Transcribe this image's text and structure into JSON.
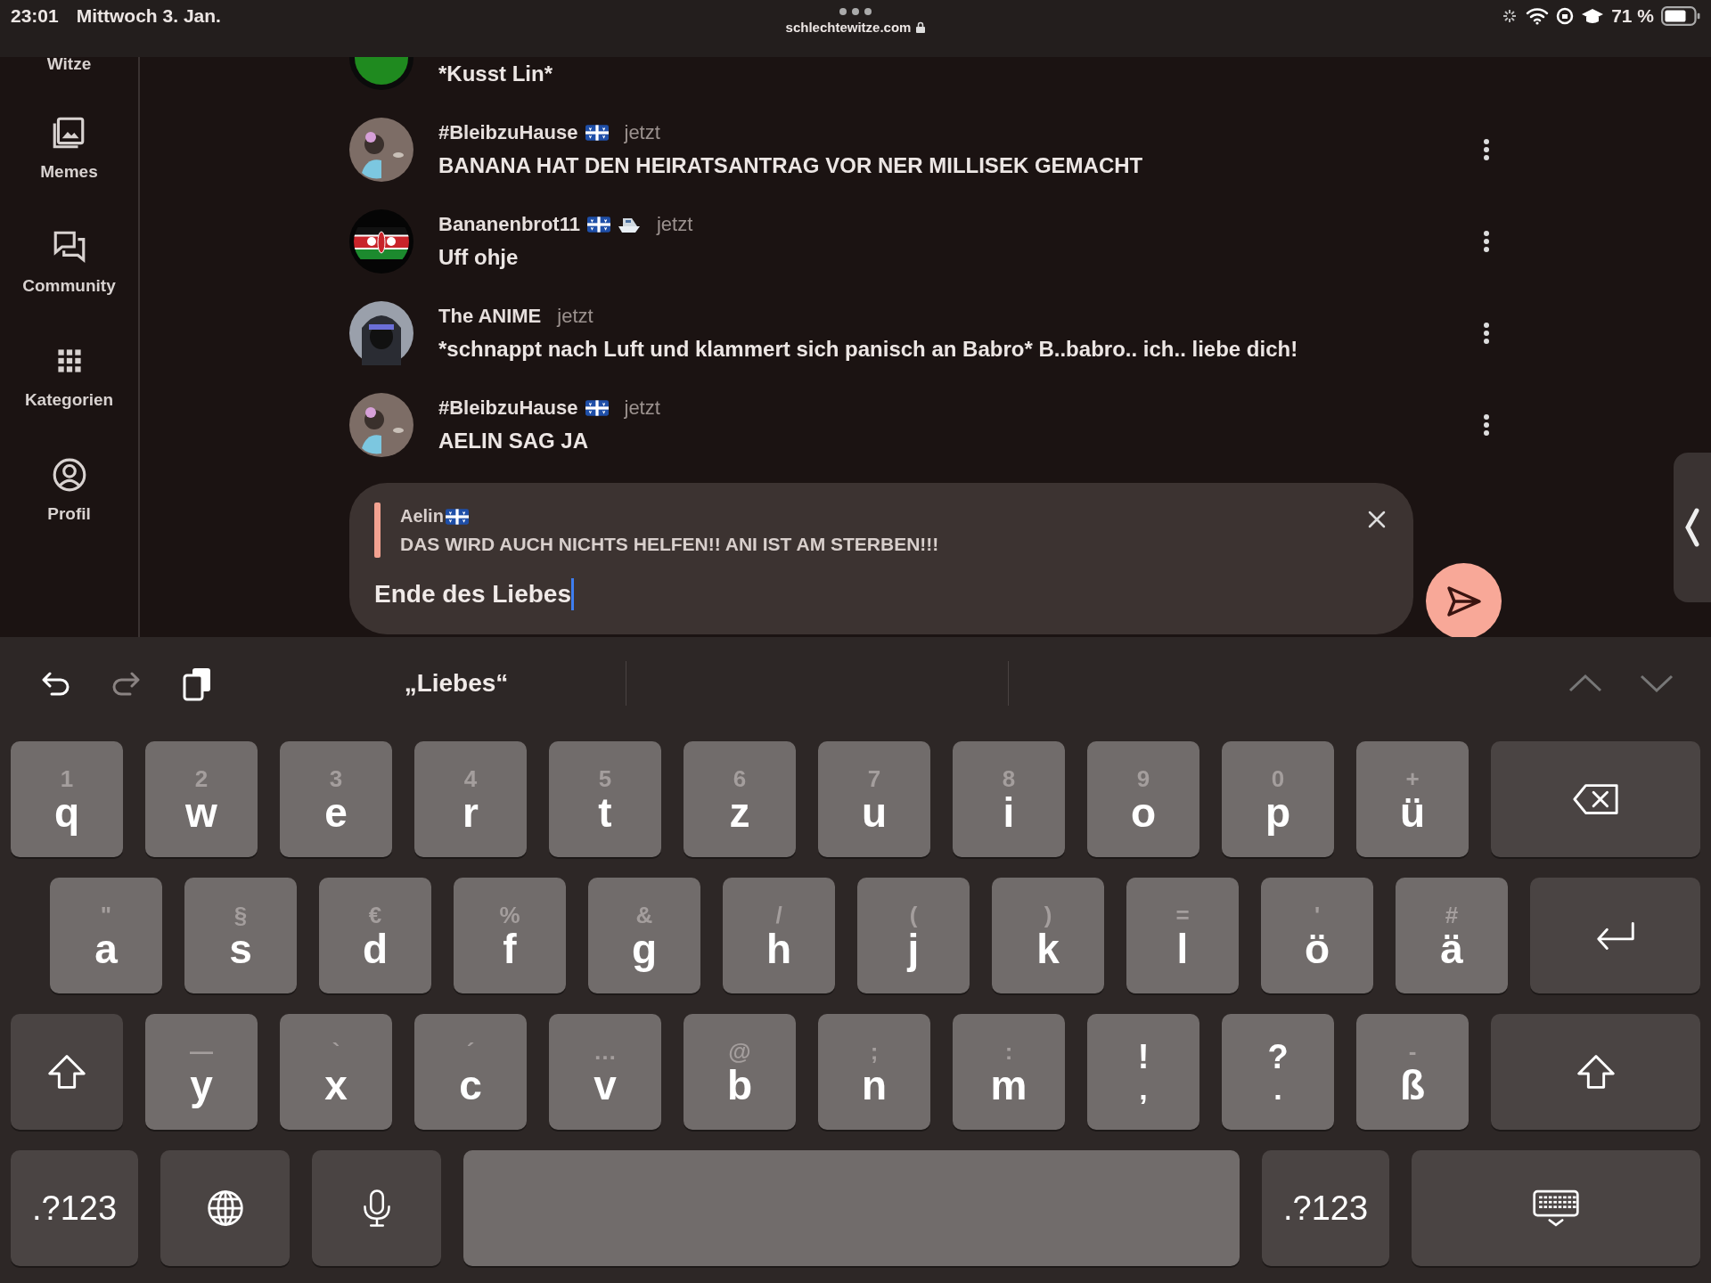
{
  "status_bar": {
    "time": "23:01",
    "date": "Mittwoch 3. Jan.",
    "url": "schlechtewitze.com",
    "battery": "71 %"
  },
  "sidebar": {
    "items": [
      {
        "label": "Witze"
      },
      {
        "label": "Memes"
      },
      {
        "label": "Community"
      },
      {
        "label": "Kategorien"
      },
      {
        "label": "Profil"
      }
    ]
  },
  "messages": [
    {
      "text": "*Kusst Lin*"
    },
    {
      "name": "#BleibzuHause",
      "flag": true,
      "boat": false,
      "time": "jetzt",
      "text": "BANANA HAT DEN HEIRATSANTRAG VOR NER MILLISEK GEMACHT"
    },
    {
      "name": "Bananenbrot11",
      "flag": true,
      "boat": true,
      "time": "jetzt",
      "text": "Uff ohje"
    },
    {
      "name": "The ANIME",
      "flag": false,
      "boat": false,
      "time": "jetzt",
      "text": "*schnappt nach Luft und klammert sich panisch an Babro* B..babro.. ich.. liebe dich!"
    },
    {
      "name": "#BleibzuHause",
      "flag": true,
      "boat": false,
      "time": "jetzt",
      "text": "AELIN SAG JA"
    }
  ],
  "composer": {
    "reply": {
      "name": "Aelin",
      "flag": true,
      "text": "DAS WIRD AUCH NICHTS HELFEN!! ANI IST AM STERBEN!!!"
    },
    "value": "Ende des Liebes"
  },
  "keyboard": {
    "suggestion": "„Liebes“",
    "rows": [
      [
        {
          "kind": "letter",
          "main": "q",
          "alt": "1"
        },
        {
          "kind": "letter",
          "main": "w",
          "alt": "2"
        },
        {
          "kind": "letter",
          "main": "e",
          "alt": "3"
        },
        {
          "kind": "letter",
          "main": "r",
          "alt": "4"
        },
        {
          "kind": "letter",
          "main": "t",
          "alt": "5"
        },
        {
          "kind": "letter",
          "main": "z",
          "alt": "6"
        },
        {
          "kind": "letter",
          "main": "u",
          "alt": "7"
        },
        {
          "kind": "letter",
          "main": "i",
          "alt": "8"
        },
        {
          "kind": "letter",
          "main": "o",
          "alt": "9"
        },
        {
          "kind": "letter",
          "main": "p",
          "alt": "0"
        },
        {
          "kind": "letter",
          "main": "ü",
          "alt": "+"
        },
        {
          "kind": "backspace"
        }
      ],
      [
        {
          "kind": "letter",
          "main": "a",
          "alt": "\""
        },
        {
          "kind": "letter",
          "main": "s",
          "alt": "§"
        },
        {
          "kind": "letter",
          "main": "d",
          "alt": "€"
        },
        {
          "kind": "letter",
          "main": "f",
          "alt": "%"
        },
        {
          "kind": "letter",
          "main": "g",
          "alt": "&"
        },
        {
          "kind": "letter",
          "main": "h",
          "alt": "/"
        },
        {
          "kind": "letter",
          "main": "j",
          "alt": "("
        },
        {
          "kind": "letter",
          "main": "k",
          "alt": ")"
        },
        {
          "kind": "letter",
          "main": "l",
          "alt": "="
        },
        {
          "kind": "letter",
          "main": "ö",
          "alt": "'"
        },
        {
          "kind": "letter",
          "main": "ä",
          "alt": "#"
        },
        {
          "kind": "return"
        }
      ],
      [
        {
          "kind": "shift"
        },
        {
          "kind": "letter",
          "main": "y",
          "alt": "—"
        },
        {
          "kind": "letter",
          "main": "x",
          "alt": "`"
        },
        {
          "kind": "letter",
          "main": "c",
          "alt": "´"
        },
        {
          "kind": "letter",
          "main": "v",
          "alt": "…"
        },
        {
          "kind": "letter",
          "main": "b",
          "alt": "@"
        },
        {
          "kind": "letter",
          "main": "n",
          "alt": ";"
        },
        {
          "kind": "letter",
          "main": "m",
          "alt": ":"
        },
        {
          "kind": "punct",
          "main": ",",
          "alt": "!"
        },
        {
          "kind": "punct",
          "main": ".",
          "alt": "?"
        },
        {
          "kind": "letter",
          "main": "ß",
          "alt": "-"
        },
        {
          "kind": "shift"
        }
      ],
      [
        {
          "kind": "mode",
          "main": ".?123"
        },
        {
          "kind": "globe"
        },
        {
          "kind": "mic"
        },
        {
          "kind": "space"
        },
        {
          "kind": "mode",
          "main": ".?123"
        },
        {
          "kind": "dismiss"
        }
      ]
    ]
  }
}
